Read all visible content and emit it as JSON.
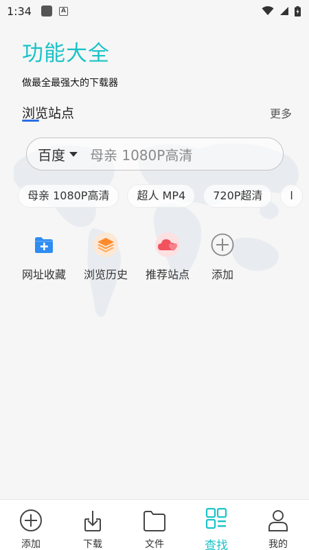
{
  "status_bar": {
    "time": "1:34"
  },
  "header": {
    "title": "功能大全",
    "subtitle": "做最全最强大的下载器"
  },
  "section": {
    "title": "浏览站点",
    "more_label": "更多"
  },
  "search": {
    "engine": "百度",
    "query": "母亲 1080P高清"
  },
  "suggestions": [
    "母亲 1080P高清",
    "超人 MP4",
    "720P超清",
    "l"
  ],
  "quick_actions": [
    {
      "label": "网址收藏",
      "icon": "folder-plus-icon"
    },
    {
      "label": "浏览历史",
      "icon": "layers-history-icon"
    },
    {
      "label": "推荐站点",
      "icon": "heart-cloud-icon"
    },
    {
      "label": "添加",
      "icon": "plus-circle-icon"
    }
  ],
  "bottom_nav": {
    "items": [
      {
        "label": "添加",
        "icon": "plus-circle-icon"
      },
      {
        "label": "下载",
        "icon": "download-icon"
      },
      {
        "label": "文件",
        "icon": "folder-icon"
      },
      {
        "label": "查找",
        "icon": "grid-search-icon"
      },
      {
        "label": "我的",
        "icon": "user-icon"
      }
    ],
    "active_label": "查找"
  },
  "colors": {
    "accent": "#1ac3c8",
    "underline": "#2b6ee6",
    "folder_blue": "#2f8cf0",
    "history_orange": "#ff8a2a",
    "heart_red": "#f0525e"
  }
}
